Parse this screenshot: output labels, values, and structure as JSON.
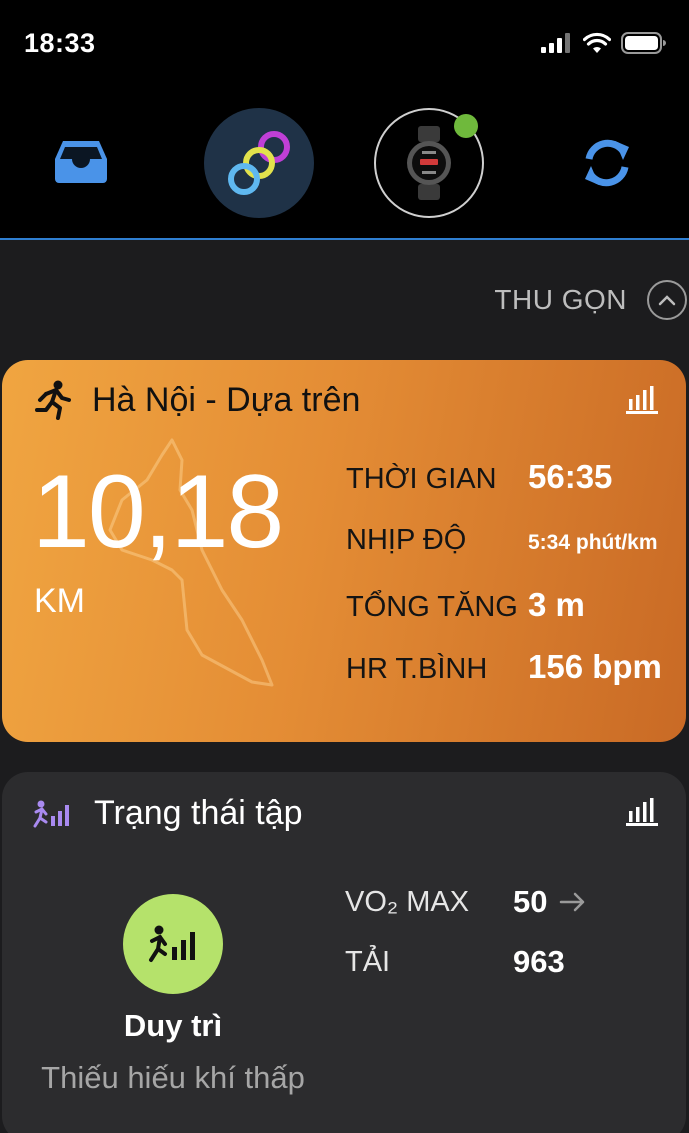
{
  "status_bar": {
    "time": "18:33",
    "signal_icon": "cellular-signal-icon",
    "wifi_icon": "wifi-icon",
    "battery_icon": "battery-icon"
  },
  "nav": {
    "inbox_icon": "inbox-tray-icon",
    "activity_icon": "connect-rings-icon",
    "device_icon": "smartwatch-icon",
    "sync_icon": "sync-arrows-icon",
    "accent_color": "#2f7fd1",
    "device_status_color": "#6fb93c"
  },
  "collapse": {
    "label": "THU GỌN",
    "icon": "chevron-up-icon"
  },
  "activity_card": {
    "title": "Hà Nội - Dựa trên",
    "activity_icon": "running-icon",
    "chart_icon": "bar-chart-icon",
    "distance": "10,18",
    "distance_unit": "KM",
    "stats": [
      {
        "label": "THỜI GIAN",
        "value": "56:35"
      },
      {
        "label": "NHỊP ĐỘ",
        "value": "5:34 phút/km"
      },
      {
        "label": "TỔNG TĂNG",
        "value": "3 m"
      },
      {
        "label": "HR T.BÌNH",
        "value": "156 bpm"
      }
    ],
    "gradient_start": "#f0a541",
    "gradient_end": "#c96a25"
  },
  "training_status": {
    "title": "Trạng thái tập",
    "title_icon": "training-status-icon",
    "chart_icon": "bar-chart-icon",
    "status": "Duy trì",
    "sub": "Thiếu hiếu khí thấp",
    "badge_color": "#b5e26b",
    "metrics": [
      {
        "label": "VO₂ MAX",
        "value": "50",
        "trend_icon": "arrow-right-icon"
      },
      {
        "label": "TẢI",
        "value": "963"
      }
    ]
  }
}
